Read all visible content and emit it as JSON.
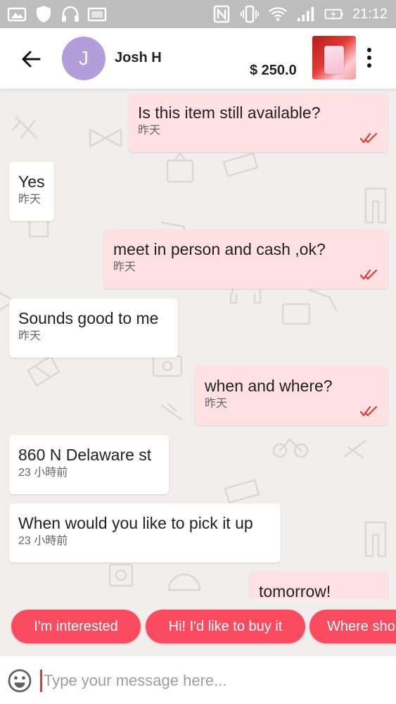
{
  "status_bar": {
    "time": "21:12"
  },
  "header": {
    "avatar_initial": "J",
    "contact_name": "Josh H",
    "price": "$ 250.0"
  },
  "messages": [
    {
      "direction": "out",
      "text": "Is this item still available?",
      "time": "昨天"
    },
    {
      "direction": "in",
      "text": "Yes",
      "time": "昨天"
    },
    {
      "direction": "out",
      "text": "meet in person and cash ,ok?",
      "time": "昨天"
    },
    {
      "direction": "in",
      "text": "Sounds good to me",
      "time": "昨天"
    },
    {
      "direction": "out",
      "text": "when and where?",
      "time": "昨天"
    },
    {
      "direction": "in",
      "text": "860 N Delaware st",
      "time": "23 小時前"
    },
    {
      "direction": "in",
      "text": "When would you like to pick it up",
      "time": "23 小時前"
    },
    {
      "direction": "out",
      "text": "tomorrow!",
      "time": ""
    }
  ],
  "quick_replies": [
    "I'm interested",
    "Hi! I'd like to buy it",
    "Where sho"
  ],
  "composer": {
    "placeholder": "Type your message here..."
  },
  "colors": {
    "accent": "#fb4b5e",
    "outgoing_bubble": "#ffe0e3",
    "read_ticks": "#e53935"
  }
}
